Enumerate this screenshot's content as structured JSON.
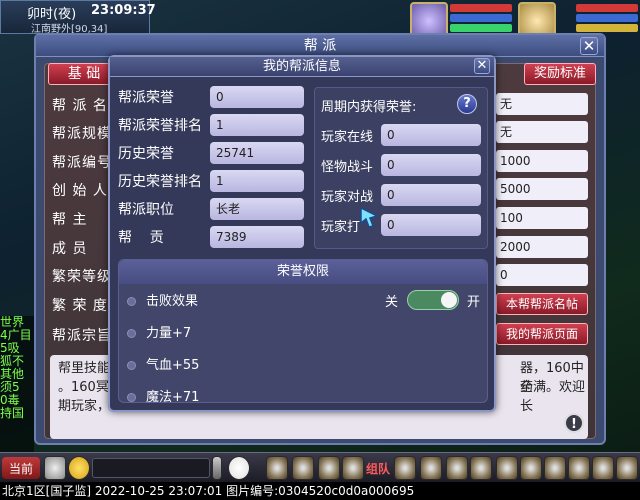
{
  "hud": {
    "time_period": "卯时(夜)",
    "clock": "23:09:37",
    "location": "江南野外[90,34]"
  },
  "chat": {
    "lines": [
      "世界",
      "4广目",
      "5吸",
      "狐不",
      "其他",
      "须5",
      "0毒",
      "持国"
    ]
  },
  "guild_window": {
    "title": "帮 派",
    "tab_basic": "基 础",
    "reward_button": "奖励标准",
    "left_labels": [
      "帮 派 名",
      "帮派规模",
      "帮派编号",
      "创 始 人",
      "帮    主",
      "成    员",
      "繁荣等级",
      "繁 荣 度",
      "帮派宗旨"
    ],
    "right_values": [
      "无",
      "无",
      "1000",
      "5000",
      "100",
      "2000",
      "0"
    ],
    "btn_guild_post": "本帮帮派名帖",
    "btn_guild_page": "我的帮派页面",
    "description": "帮里技能…… 器，160中药。160冥…… 全满。欢迎长期玩家，",
    "desc_line1": "帮里技能",
    "desc_line1b": "器，160中药",
    "desc_line2": "。160冥",
    "desc_line2b": "全满。欢迎长",
    "desc_line3": "期玩家，"
  },
  "dialog": {
    "title": "我的帮派信息",
    "stats": [
      {
        "label": "帮派荣誉",
        "value": "0"
      },
      {
        "label": "帮派荣誉排名",
        "value": "1"
      },
      {
        "label": "历史荣誉",
        "value": "25741"
      },
      {
        "label": "历史荣誉排名",
        "value": "1"
      },
      {
        "label": "帮派职位",
        "value": "长老"
      },
      {
        "label": "帮    贡",
        "value": "7389"
      }
    ],
    "period": {
      "title": "周期内获得荣誉:",
      "help": "?",
      "rows": [
        {
          "label": "玩家在线",
          "value": "0"
        },
        {
          "label": "怪物战斗",
          "value": "0"
        },
        {
          "label": "玩家对战",
          "value": "0"
        },
        {
          "label": "玩家打",
          "value": "0"
        }
      ]
    },
    "honor": {
      "title": "荣誉权限",
      "perms": [
        "击败效果",
        "力量+7",
        "气血+55",
        "魔法+71"
      ],
      "toggle_off": "关",
      "toggle_on": "开",
      "toggle_state": "on"
    }
  },
  "toolbar": {
    "current_channel": "当前",
    "team": "组队"
  },
  "status_line": "北京1区[国子监] 2022-10-25 23:07:01 图片编号:0304520c0d0a000695"
}
